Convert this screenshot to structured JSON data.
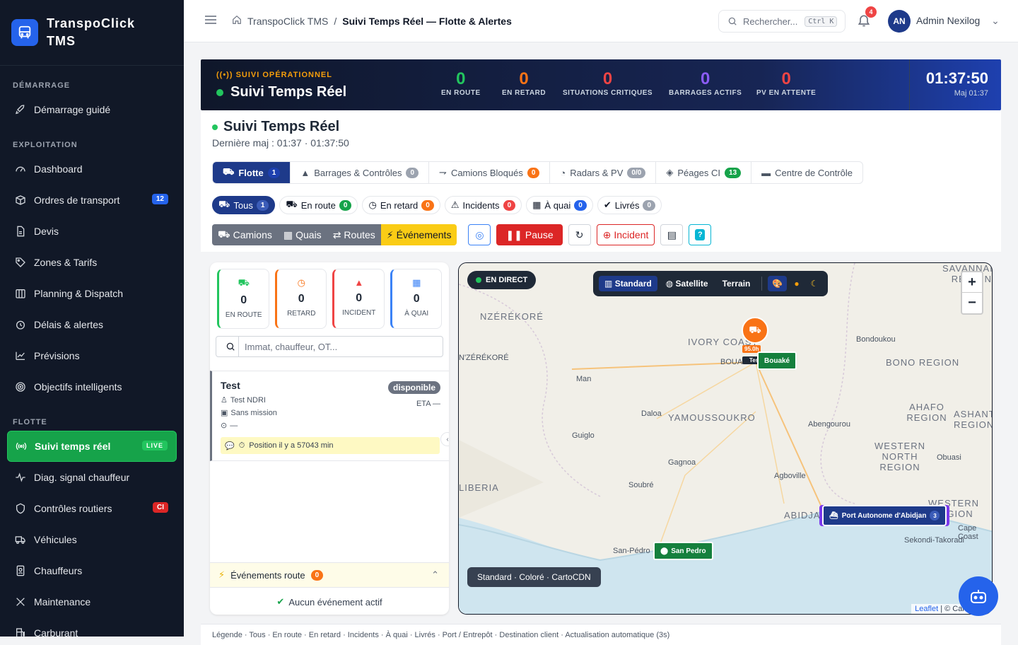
{
  "brand": {
    "line1": "TranspoClick",
    "line2": "TMS"
  },
  "sidebar": {
    "sections": [
      "DÉMARRAGE",
      "EXPLOITATION",
      "FLOTTE"
    ],
    "items": [
      {
        "label": "Démarrage guidé"
      },
      {
        "label": "Dashboard"
      },
      {
        "label": "Ordres de transport",
        "badge": "12"
      },
      {
        "label": "Devis"
      },
      {
        "label": "Zones & Tarifs"
      },
      {
        "label": "Planning & Dispatch"
      },
      {
        "label": "Délais & alertes"
      },
      {
        "label": "Prévisions"
      },
      {
        "label": "Objectifs intelligents"
      },
      {
        "label": "Suivi temps réel",
        "badge": "LIVE"
      },
      {
        "label": "Diag. signal chauffeur"
      },
      {
        "label": "Contrôles routiers",
        "badge": "CI"
      },
      {
        "label": "Véhicules"
      },
      {
        "label": "Chauffeurs"
      },
      {
        "label": "Maintenance"
      },
      {
        "label": "Carburant"
      }
    ]
  },
  "topbar": {
    "crumb_root": "TranspoClick TMS",
    "crumb_sep": "/",
    "crumb_current": "Suivi Temps Réel — Flotte & Alertes",
    "search_placeholder": "Rechercher...",
    "search_kbd": "Ctrl K",
    "notif_count": "4",
    "avatar": "AN",
    "user": "Admin Nexilog"
  },
  "hero": {
    "kicker": "SUIVI OPÉRATIONNEL",
    "title": "Suivi Temps Réel",
    "stats": [
      {
        "value": "0",
        "label": "EN ROUTE",
        "color": "#22c55e"
      },
      {
        "value": "0",
        "label": "EN RETARD",
        "color": "#f97316"
      },
      {
        "value": "0",
        "label": "SITUATIONS CRITIQUES",
        "color": "#ef4444"
      },
      {
        "value": "0",
        "label": "BARRAGES ACTIFS",
        "color": "#8b5cf6"
      },
      {
        "value": "0",
        "label": "PV EN ATTENTE",
        "color": "#ef4444"
      }
    ],
    "time": "01:37:50",
    "updated": "Maj 01:37"
  },
  "panel": {
    "title": "Suivi Temps Réel",
    "subtitle": "Dernière maj : 01:37 · 01:37:50",
    "tabs": [
      {
        "label": "Flotte",
        "count": "1"
      },
      {
        "label": "Barrages & Contrôles",
        "count": "0"
      },
      {
        "label": "Camions Bloqués",
        "count": "0"
      },
      {
        "label": "Radars & PV",
        "count": "0/0"
      },
      {
        "label": "Péages CI",
        "count": "13"
      },
      {
        "label": "Centre de Contrôle"
      }
    ],
    "filters": [
      {
        "label": "Tous",
        "count": "1"
      },
      {
        "label": "En route",
        "count": "0"
      },
      {
        "label": "En retard",
        "count": "0"
      },
      {
        "label": "Incidents",
        "count": "0"
      },
      {
        "label": "À quai",
        "count": "0"
      },
      {
        "label": "Livrés",
        "count": "0"
      }
    ],
    "views": [
      "Camions",
      "Quais",
      "Routes",
      "Événements"
    ],
    "pause": "Pause",
    "incident": "Incident"
  },
  "left": {
    "kpis": [
      {
        "value": "0",
        "label": "EN ROUTE",
        "color": "#22c55e"
      },
      {
        "value": "0",
        "label": "RETARD",
        "color": "#f97316"
      },
      {
        "value": "0",
        "label": "INCIDENT",
        "color": "#ef4444"
      },
      {
        "value": "0",
        "label": "À QUAI",
        "color": "#3b82f6"
      }
    ],
    "search_placeholder": "Immat, chauffeur, OT...",
    "vehicle": {
      "name": "Test",
      "status": "disponible",
      "driver": "Test NDRI",
      "mission": "Sans mission",
      "location": "—",
      "eta": "ETA —",
      "position": "Position il y a 57043 min"
    },
    "events_title": "Événements route",
    "events_count": "0",
    "events_empty": "Aucun événement actif"
  },
  "map": {
    "live": "EN DIRECT",
    "styles": [
      "Standard",
      "Satellite",
      "Terrain"
    ],
    "places": [
      {
        "name": "NZÉRÉKORÉ",
        "big": true
      },
      {
        "name": "N'ZÉRÉKORÉ"
      },
      {
        "name": "IVORY COAST",
        "big": true
      },
      {
        "name": "BOUAKÉ",
        "big": true
      },
      {
        "name": "Bondoukou"
      },
      {
        "name": "BONO REGION",
        "big": true
      },
      {
        "name": "Man"
      },
      {
        "name": "Daloa"
      },
      {
        "name": "YAMOUSSOUKRO",
        "big": true
      },
      {
        "name": "Abengourou"
      },
      {
        "name": "AHAFO REGION",
        "big": true
      },
      {
        "name": "ASHANTI REGION",
        "big": true
      },
      {
        "name": "Guiglo"
      },
      {
        "name": "WESTERN NORTH REGION",
        "big": true
      },
      {
        "name": "Obuasi"
      },
      {
        "name": "Gagnoa"
      },
      {
        "name": "Agboville"
      },
      {
        "name": "LIBERIA",
        "big": true
      },
      {
        "name": "Soubré"
      },
      {
        "name": "WESTERN REGION",
        "big": true
      },
      {
        "name": "ABIDJAN",
        "big": true
      },
      {
        "name": "Cape Coast"
      },
      {
        "name": "Sekondi-Takoradi"
      },
      {
        "name": "San-Pédro"
      },
      {
        "name": "SAVANNAH REGION",
        "big": true
      }
    ],
    "truck_speed": "95.0h",
    "truck_label": "Test",
    "pin_bouake": "Bouaké",
    "pin_sanpedro": "San Pedro",
    "port": "Port Autonome d'Abidjan",
    "port_count": "3",
    "footer": "Standard · Coloré · CartoCDN",
    "attr_link": "Leaflet",
    "attr_rest": "| © CartoCDN"
  },
  "legend": "Légende · Tous · En route · En retard · Incidents · À quai · Livrés · Port / Entrepôt · Destination client · Actualisation automatique (3s)"
}
